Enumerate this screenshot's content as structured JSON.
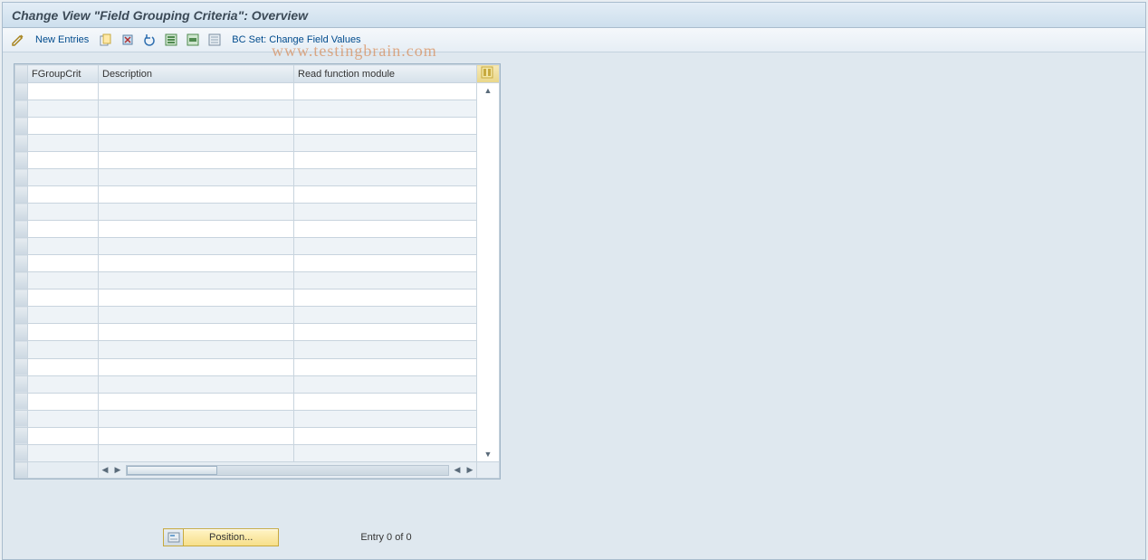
{
  "title": "Change View \"Field Grouping Criteria\": Overview",
  "toolbar": {
    "new_entries": "New Entries",
    "bc_set": "BC Set: Change Field Values"
  },
  "table": {
    "columns": {
      "fgroupcrit": "FGroupCrit",
      "description": "Description",
      "read_fn": "Read function module"
    },
    "rows": 22
  },
  "position_button": "Position...",
  "entry_status": "Entry 0 of 0",
  "watermark": "www.testingbrain.com"
}
